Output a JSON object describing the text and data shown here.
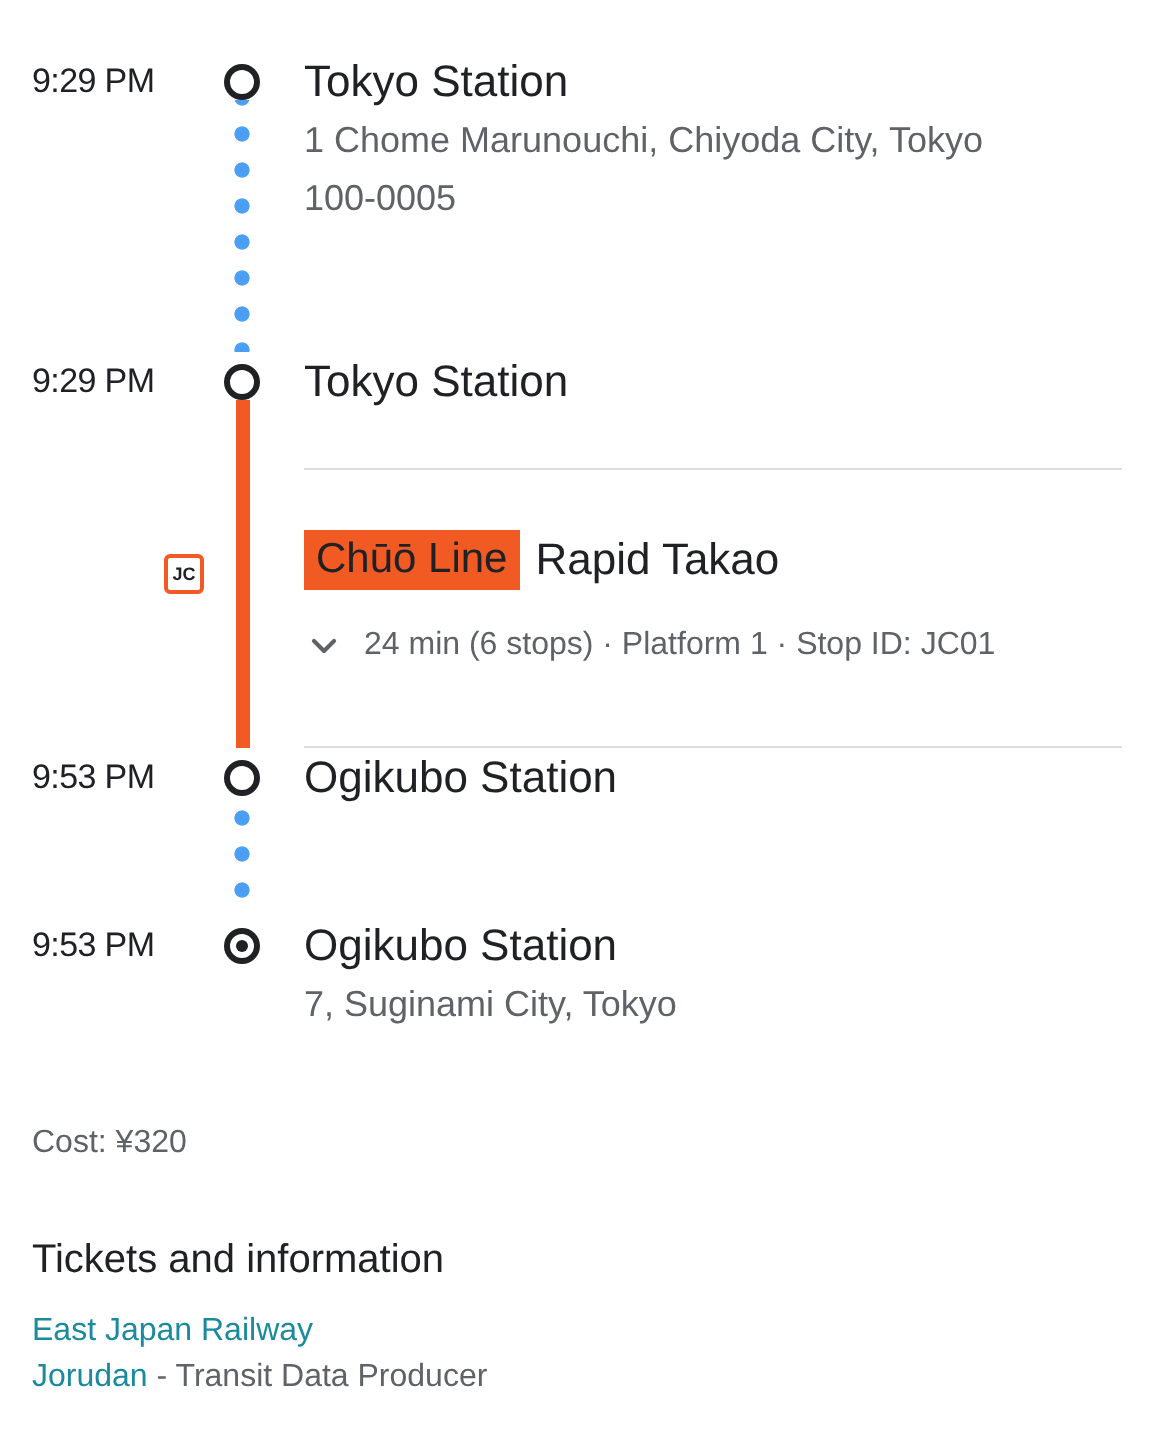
{
  "itinerary": [
    {
      "kind": "stop",
      "time": "9:29 PM",
      "name": "Tokyo Station",
      "address": "1 Chome Marunouchi, Chiyoda City, Tokyo 100-0005",
      "destination": false
    },
    {
      "kind": "walk"
    },
    {
      "kind": "stop",
      "time": "9:29 PM",
      "name": "Tokyo Station",
      "destination": false
    },
    {
      "kind": "transit",
      "code": "JC",
      "color": "#f15a22",
      "line": "Chūō Line",
      "headsign": "Rapid Takao",
      "details": "24 min (6 stops) · Platform 1 · Stop ID: JC01",
      "expanded": false
    },
    {
      "kind": "stop",
      "time": "9:53 PM",
      "name": "Ogikubo Station",
      "destination": false
    },
    {
      "kind": "walk"
    },
    {
      "kind": "stop",
      "time": "9:53 PM",
      "name": "Ogikubo Station",
      "address": "7, Suginami City, Tokyo",
      "destination": true
    }
  ],
  "cost": "Cost: ¥320",
  "tickets": {
    "title": "Tickets and information",
    "providers": [
      {
        "name": "East Japan Railway"
      },
      {
        "name": "Jorudan",
        "role": "- Transit Data Producer"
      }
    ]
  }
}
